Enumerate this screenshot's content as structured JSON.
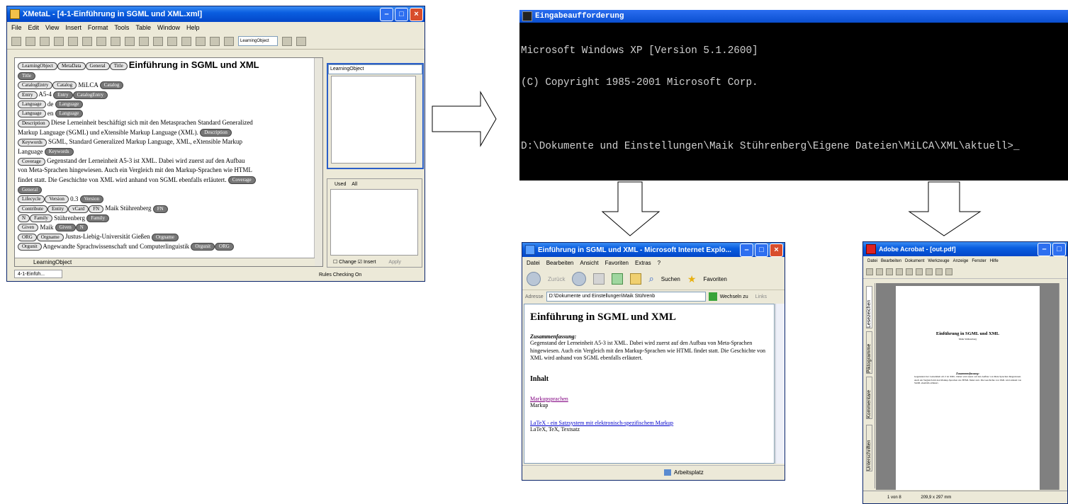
{
  "xmetal": {
    "title": "XMetaL - [4-1-Einführung in SGML und XML.xml]",
    "menu": [
      "File",
      "Edit",
      "View",
      "Insert",
      "Format",
      "Tools",
      "Table",
      "Window",
      "Help"
    ],
    "element_dropdown": "LearningObject",
    "side_dropdown": "LearningObject",
    "doc_heading": "Einführung in SGML und XML",
    "lines": [
      {
        "tags_open": [
          "LearningObject",
          "MetaData",
          "General",
          "Title"
        ],
        "text": "",
        "tags_close": []
      },
      {
        "tags_open": [],
        "text": "",
        "tags_close": [
          "Title"
        ]
      },
      {
        "tags_open": [
          "CatalogEntry",
          "Catalog"
        ],
        "text": "MiLCA",
        "tags_close": [
          "Catalog"
        ]
      },
      {
        "tags_open": [
          "Entry"
        ],
        "text": "A5-4",
        "tags_close": [
          "Entry",
          "CatalogEntry"
        ]
      },
      {
        "tags_open": [
          "Language"
        ],
        "text": "de",
        "tags_close": [
          "Language"
        ]
      },
      {
        "tags_open": [
          "Language"
        ],
        "text": "en",
        "tags_close": [
          "Language"
        ]
      },
      {
        "tags_open": [
          "Description"
        ],
        "text": "Diese Lerneinheit beschäftigt sich mit den Metasprachen Standard Generalized",
        "tags_close": []
      },
      {
        "tags_open": [],
        "text": "Markup Language (SGML) und eXtensible Markup Language (XML).",
        "tags_close": [
          "Description"
        ]
      },
      {
        "tags_open": [
          "Keywords"
        ],
        "text": "SGML, Standard Generalized Markup Language, XML, eXtensible Markup",
        "tags_close": []
      },
      {
        "tags_open": [],
        "text": "Language",
        "tags_close": [
          "Keywords"
        ]
      },
      {
        "tags_open": [
          "Coverage"
        ],
        "text": "Gegenstand der Lerneinheit A5-3 ist XML. Dabei wird zuerst auf den Aufbau",
        "tags_close": []
      },
      {
        "tags_open": [],
        "text": "von Meta-Sprachen hingewiesen. Auch ein Vergleich mit den Markup-Sprachen wie HTML",
        "tags_close": []
      },
      {
        "tags_open": [],
        "text": "findet statt. Die Geschichte von XML wird anhand von SGML ebenfalls erläutert.",
        "tags_close": [
          "Coverage"
        ]
      },
      {
        "tags_open": [],
        "text": "",
        "tags_close": [
          "General"
        ]
      },
      {
        "tags_open": [
          "Lifecycle",
          "Version"
        ],
        "text": "0.3",
        "tags_close": [
          "Version"
        ]
      },
      {
        "tags_open": [
          "Contribute",
          "Entity",
          "vCard",
          "FN"
        ],
        "text": "Maik Stührenberg",
        "tags_close": [
          "FN"
        ]
      },
      {
        "tags_open": [
          "N",
          "Family"
        ],
        "text": "Stührenberg",
        "tags_close": [
          "Family"
        ]
      },
      {
        "tags_open": [
          "Given"
        ],
        "text": "Maik",
        "tags_close": [
          "Given",
          "N"
        ]
      },
      {
        "tags_open": [
          "ORG",
          "Orgname"
        ],
        "text": "Justus-Liebig-Universität Gießen",
        "tags_close": [
          "Orgname"
        ]
      },
      {
        "tags_open": [
          "Orgunit"
        ],
        "text": "Angewandte Sprachwissenschaft und Computerlinguistik",
        "tags_close": [
          "Orgunit",
          "ORG"
        ]
      }
    ],
    "bottom_tab": "LearningObject",
    "panel_tabs": [
      "Used",
      "All"
    ],
    "change_label": "Change",
    "insert_label": "Insert",
    "apply_label": "Apply",
    "task_tab": "4-1-Einfüh...",
    "status": "Rules Checking On"
  },
  "cmd": {
    "title": "Eingabeaufforderung",
    "lines": [
      "Microsoft Windows XP [Version 5.1.2600]",
      "(C) Copyright 1985-2001 Microsoft Corp.",
      "",
      "D:\\Dokumente und Einstellungen\\Maik Stührenberg\\Eigene Dateien\\MiLCA\\XML\\aktuell>_"
    ]
  },
  "ie": {
    "title": "Einführung in SGML und XML - Microsoft Internet Explo...",
    "menu": [
      "Datei",
      "Bearbeiten",
      "Ansicht",
      "Favoriten",
      "Extras",
      "?"
    ],
    "back": "Zurück",
    "search": "Suchen",
    "favorites": "Favoriten",
    "address_label": "Adresse",
    "address": "D:\\Dokumente und Einstellungen\\Maik Stührenb",
    "go": "Wechseln zu",
    "links": "Links",
    "heading": "Einführung in SGML und XML",
    "summary_label": "Zusammenfassung:",
    "summary": "Gegenstand der Lerneinheit A5-3 ist XML. Dabei wird zuerst auf den Aufbau von Meta-Sprachen hingewiesen. Auch ein Vergleich mit den Markup-Sprachen wie HTML findet statt. Die Geschichte von XML wird anhand von SGML ebenfalls erläutert.",
    "toc": "Inhalt",
    "link1": "Markupsprachen",
    "text1": "Markup",
    "link2": "LaTeX - ein Satzsystem mit elektronisch-spezifischem Markup",
    "text2": "LaTeX, TeX, Textsatz",
    "status": "Arbeitsplatz"
  },
  "acrobat": {
    "title": "Adobe Acrobat - [out.pdf]",
    "menu": [
      "Datei",
      "Bearbeiten",
      "Dokument",
      "Werkzeuge",
      "Anzeige",
      "Fenster",
      "Hilfe"
    ],
    "side_tabs": [
      "Lesezeichen",
      "Piktogramme",
      "Kommentare",
      "Unterschriften"
    ],
    "page_title": "Einführung in SGML und XML",
    "page_author": "Maik Stührenberg",
    "page_summary_label": "Zusammenfassung:",
    "page_summary": "Gegenstand der Lerneinheit A5-3 ist XML. Dabei wird zuerst auf den Aufbau von Meta-Sprachen hingewiesen. Auch ein Vergleich mit den Markup-Sprachen wie HTML findet statt. Die Geschichte von XML wird anhand von SGML ebenfalls erläutert.",
    "page_info": "1 von 8",
    "page_size": "209,9 x 297 mm"
  }
}
